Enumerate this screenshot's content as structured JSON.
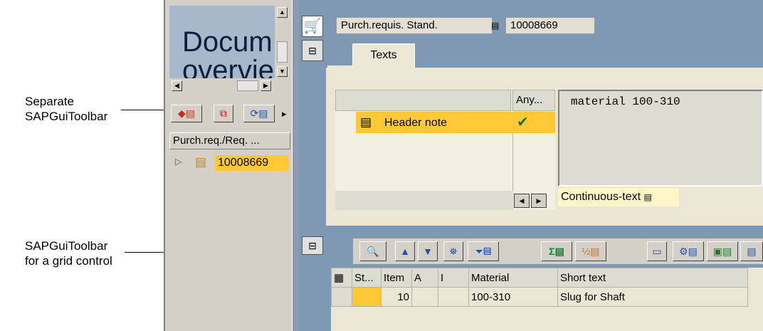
{
  "callouts": {
    "separate_toolbar": [
      "Separate",
      "SAPGuiToolbar"
    ],
    "grid_toolbar": [
      "SAPGuiToolbar",
      "for a grid control"
    ]
  },
  "left": {
    "doc_overview_text": [
      "Docum",
      "overvie"
    ],
    "column_header": "Purch.req./Req. ...",
    "tree_item": "10008669"
  },
  "header": {
    "doc_type": "Purch.requis. Stand.",
    "doc_number": "10008669"
  },
  "tabs": [
    {
      "label": "Texts"
    }
  ],
  "texts": {
    "any_col": "Any...",
    "row_label": "Header note",
    "editor_text": "material 100-310",
    "text_format": "Continuous-text"
  },
  "grid": {
    "columns": [
      "St...",
      "Item",
      "A",
      "I",
      "Material",
      "Short text"
    ],
    "rows": [
      {
        "status": "",
        "item": "10",
        "a": "",
        "i": "",
        "material": "100-310",
        "short_text": "Slug for Shaft"
      }
    ]
  },
  "colors": {
    "accent": "#ffc936",
    "background": "#7f98b3",
    "panel": "#ece7d5"
  }
}
